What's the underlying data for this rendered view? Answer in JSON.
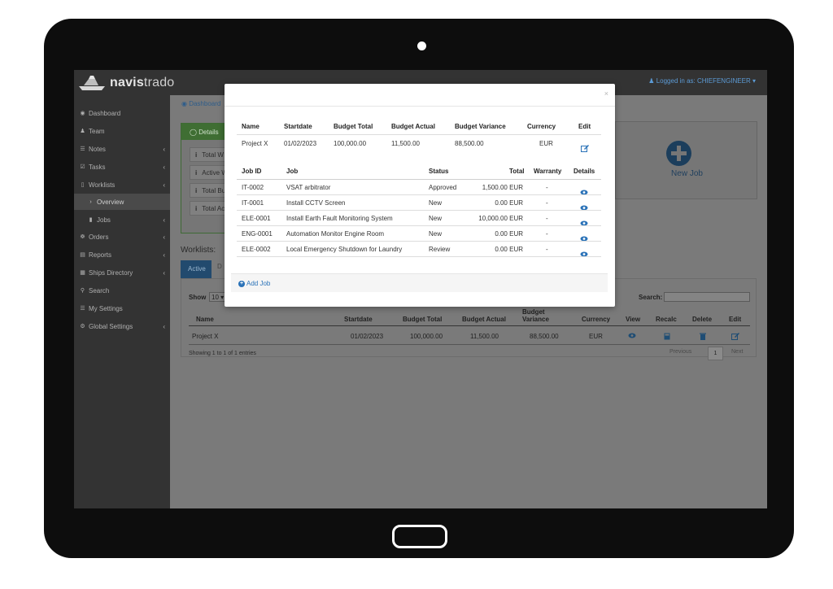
{
  "app": {
    "brand_bold": "navis",
    "brand_light": "trado",
    "logged_in": "Logged in as: CHIEFENGINEER"
  },
  "sidebar": {
    "items": [
      {
        "label": "Dashboard",
        "icon": "dashboard-icon"
      },
      {
        "label": "Team",
        "icon": "team-icon"
      },
      {
        "label": "Notes",
        "icon": "notes-icon"
      },
      {
        "label": "Tasks",
        "icon": "tasks-icon"
      },
      {
        "label": "Worklists",
        "icon": "worklists-icon"
      },
      {
        "label": "Overview",
        "icon": "chevron-right-icon"
      },
      {
        "label": "Jobs",
        "icon": "jobs-icon"
      },
      {
        "label": "Orders",
        "icon": "cart-icon"
      },
      {
        "label": "Reports",
        "icon": "reports-icon"
      },
      {
        "label": "Ships Directory",
        "icon": "directory-icon"
      },
      {
        "label": "Search",
        "icon": "search-icon"
      },
      {
        "label": "My Settings",
        "icon": "settings-icon"
      },
      {
        "label": "Global Settings",
        "icon": "globe-icon"
      }
    ]
  },
  "main": {
    "breadcrumb": "Dashboard",
    "details_tab": "Details",
    "details_rows": [
      "Total W",
      "Active W",
      "Total Bu",
      "Total Ac"
    ],
    "new_job_label": "New Job",
    "worklists_title": "Worklists:",
    "tab_active": "Active",
    "tab_other": "D",
    "show_label": "Show",
    "show_value": "10",
    "search_label": "Search:",
    "columns": {
      "name": "Name",
      "startdate": "Startdate",
      "budget_total": "Budget Total",
      "budget_actual": "Budget Actual",
      "budget_variance_1": "Budget",
      "budget_variance_2": "Variance",
      "currency": "Currency",
      "view": "View",
      "recalc": "Recalc",
      "delete": "Delete",
      "edit": "Edit"
    },
    "row": {
      "name": "Project X",
      "startdate": "01/02/2023",
      "budget_total": "100,000.00",
      "budget_actual": "11,500.00",
      "budget_variance": "88,500.00",
      "currency": "EUR"
    },
    "showing": "Showing 1 to 1 of 1 entries",
    "pager_prev": "Previous",
    "pager_page": "1",
    "pager_next": "Next"
  },
  "modal": {
    "close": "×",
    "summary_headers": {
      "name": "Name",
      "startdate": "Startdate",
      "budget_total": "Budget Total",
      "budget_actual": "Budget Actual",
      "budget_variance": "Budget Variance",
      "currency": "Currency",
      "edit": "Edit"
    },
    "summary_row": {
      "name": "Project X",
      "startdate": "01/02/2023",
      "budget_total": "100,000.00",
      "budget_actual": "11,500.00",
      "budget_variance": "88,500.00",
      "currency": "EUR"
    },
    "jobs_headers": {
      "job_id": "Job ID",
      "job": "Job",
      "status": "Status",
      "total": "Total",
      "warranty": "Warranty",
      "details": "Details"
    },
    "jobs": [
      {
        "job_id": "IT-0002",
        "job": "VSAT arbitrator",
        "status": "Approved",
        "total": "1,500.00 EUR",
        "warranty": "-"
      },
      {
        "job_id": "IT-0001",
        "job": "Install CCTV Screen",
        "status": "New",
        "total": "0.00 EUR",
        "warranty": "-"
      },
      {
        "job_id": "ELE-0001",
        "job": "Install Earth Fault Monitoring System",
        "status": "New",
        "total": "10,000.00 EUR",
        "warranty": "-"
      },
      {
        "job_id": "ENG-0001",
        "job": "Automation Monitor Engine Room",
        "status": "New",
        "total": "0.00 EUR",
        "warranty": "-"
      },
      {
        "job_id": "ELE-0002",
        "job": "Local Emergency Shutdown for Laundry",
        "status": "Review",
        "total": "0.00 EUR",
        "warranty": "-"
      }
    ],
    "add_job": "Add Job"
  },
  "colors": {
    "link_blue": "#2a72b8",
    "dark_chrome": "#333333",
    "tablet_bezel": "#0d0d0d"
  }
}
